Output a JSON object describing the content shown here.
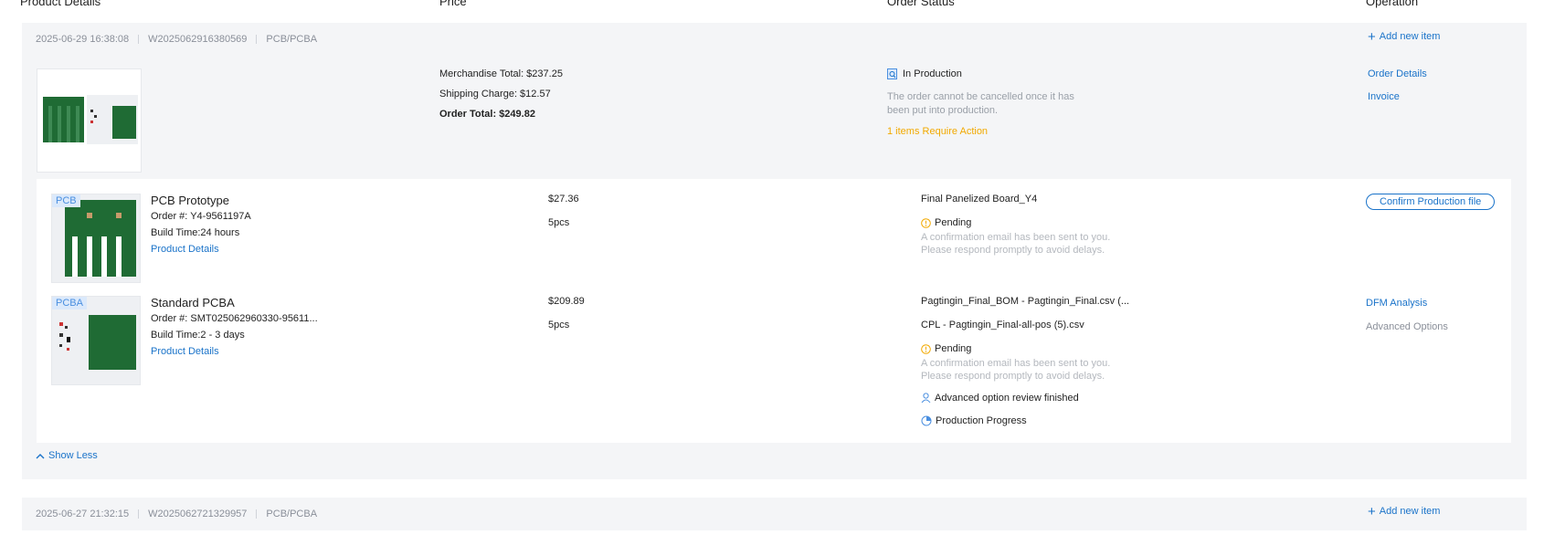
{
  "headers": {
    "product_details": "Product Details",
    "price": "Price",
    "order_status": "Order Status",
    "operation": "Operation"
  },
  "orders": [
    {
      "date": "2025-06-29 16:38:08",
      "number": "W2025062916380569",
      "type": "PCB/PCBA",
      "add_item": "Add new item",
      "merch_total": "Merchandise Total: $237.25",
      "shipping": "Shipping Charge: $12.57",
      "order_total": "Order Total: $249.82",
      "status": "In Production",
      "status_note": "The order cannot be cancelled once it has been put into production.",
      "action_required": "1 items Require Action",
      "order_details_link": "Order Details",
      "invoice_link": "Invoice",
      "items": [
        {
          "tag": "PCB",
          "name": "PCB Prototype",
          "order_no": "Order #: Y4-9561197A",
          "build_time": "Build Time:24 hours",
          "details_link": "Product Details",
          "price": "$27.36",
          "qty": "5pcs",
          "file": "Final Panelized Board_Y4",
          "state": "Pending",
          "note": "A confirmation email has been sent to you. Please respond promptly to avoid delays.",
          "op_button": "Confirm Production file"
        },
        {
          "tag": "PCBA",
          "name": "Standard PCBA",
          "order_no": "Order #: SMT025062960330-95611...",
          "build_time": "Build Time:2 - 3 days",
          "details_link": "Product Details",
          "price": "$209.89",
          "qty": "5pcs",
          "file_bom": "Pagtingin_Final_BOM - Pagtingin_Final.csv (...",
          "file_cpl": "CPL - Pagtingin_Final-all-pos (5).csv",
          "state": "Pending",
          "note": "A confirmation email has been sent to you. Please respond promptly to avoid delays.",
          "review": "Advanced option review finished",
          "progress": "Production Progress",
          "op_dfm": "DFM Analysis",
          "op_advanced": "Advanced Options"
        }
      ],
      "show_less": "Show Less"
    },
    {
      "date": "2025-06-27 21:32:15",
      "number": "W2025062721329957",
      "type": "PCB/PCBA",
      "add_item": "Add new item"
    }
  ],
  "colors": {
    "accent": "#1a73c9",
    "warning": "#f2a900",
    "panel": "#f4f5f7",
    "pcb_green": "#1f6b34"
  },
  "icons": {
    "plus": "plus-icon",
    "production": "production-icon",
    "pending": "clock-alert-icon",
    "review": "user-icon",
    "progress": "progress-icon",
    "chevron_up": "chevron-up-icon"
  }
}
